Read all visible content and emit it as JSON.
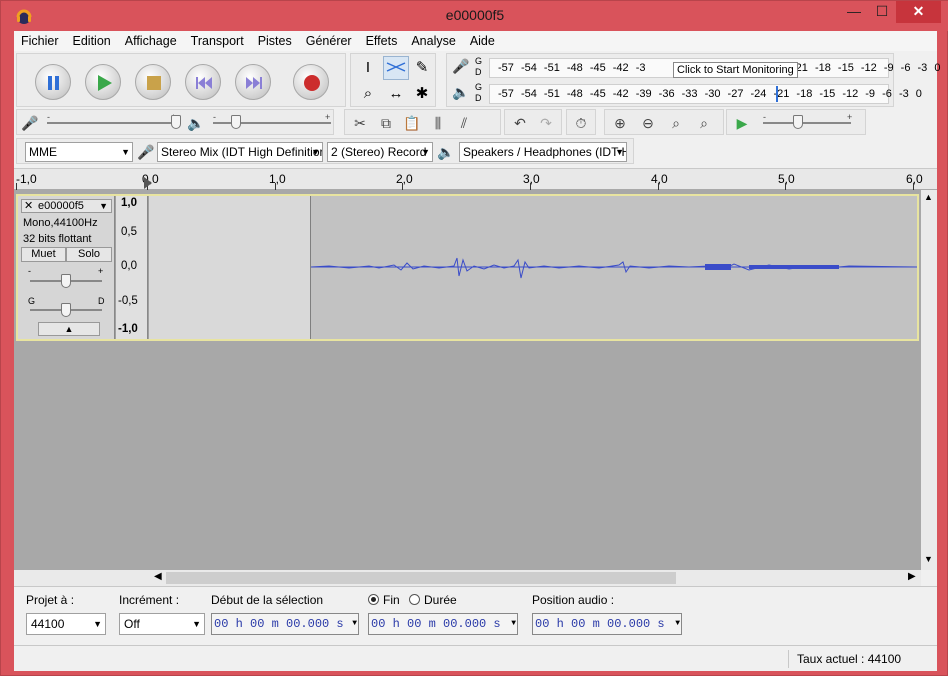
{
  "window": {
    "title": "e00000f5",
    "minimize": "—",
    "maximize": "☐",
    "close": "✕"
  },
  "menu": [
    "Fichier",
    "Edition",
    "Affichage",
    "Transport",
    "Pistes",
    "Générer",
    "Effets",
    "Analyse",
    "Aide"
  ],
  "meters": {
    "record_ticks": "-57 -54 -51 -48 -45 -42 -3",
    "record_ticks_right": "-21 -18 -15 -12 -9 -6 -3 0",
    "monitor_tooltip": "Click to Start Monitoring",
    "playback_ticks": "-57 -54 -51 -48 -45 -42 -39 -36 -33 -30 -27 -24 -21 -18 -15 -12 -9 -6 -3 0",
    "g": "G",
    "d": "D"
  },
  "mixer": {
    "minus": "-",
    "plus": "+"
  },
  "devices": {
    "host": "MME",
    "input": "Stereo Mix (IDT High Definitior",
    "channels": "2 (Stereo) Record",
    "output": "Speakers / Headphones (IDT H"
  },
  "ruler": [
    "-1,0",
    "0,0",
    "1,0",
    "2,0",
    "3,0",
    "4,0",
    "5,0",
    "6,0"
  ],
  "track": {
    "name": "e00000f5",
    "info1": "Mono,44100Hz",
    "info2": "32 bits flottant",
    "mute": "Muet",
    "solo": "Solo",
    "gain_minus": "-",
    "gain_plus": "+",
    "pan_left": "G",
    "pan_right": "D",
    "scale": [
      "1,0",
      "0,5",
      "0,0",
      "-0,5",
      "-1,0"
    ]
  },
  "selection": {
    "project_rate_label": "Projet à :",
    "project_rate": "44100",
    "snap_label": "Incrément :",
    "snap": "Off",
    "start_label": "Début de la sélection",
    "end_label": "Fin",
    "length_label": "Durée",
    "audio_pos_label": "Position audio :",
    "time_value": "00 h 00 m 00.000 s"
  },
  "status": {
    "rate": "Taux actuel : 44100"
  },
  "colors": {
    "titlebar": "#d9535b",
    "waveform": "#3a4cc9",
    "track_border": "#e8e4a0"
  }
}
